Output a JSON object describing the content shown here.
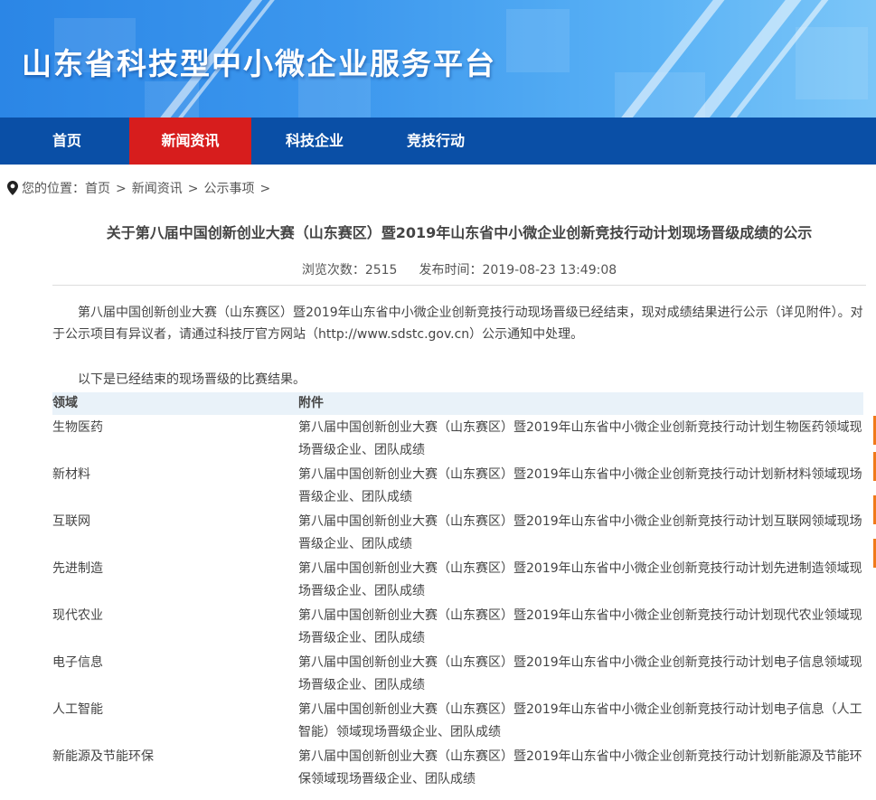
{
  "site": {
    "title": "山东省科技型中小微企业服务平台"
  },
  "nav": {
    "items": [
      {
        "label": "首页"
      },
      {
        "label": "新闻资讯"
      },
      {
        "label": "科技企业"
      },
      {
        "label": "竞技行动"
      }
    ],
    "active": "新闻资讯"
  },
  "breadcrumb": {
    "icon": "location-pin-icon",
    "prefix": "您的位置：",
    "items": [
      "首页",
      "新闻资讯",
      "公示事项"
    ],
    "separator": ">"
  },
  "article": {
    "title": "关于第八届中国创新创业大赛（山东赛区）暨2019年山东省中小微企业创新竞技行动计划现场晋级成绩的公示",
    "views_label": "浏览次数：",
    "views": "2515",
    "date_label": "发布时间：",
    "date": "2019-08-23 13:49:08",
    "paragraph1": "第八届中国创新创业大赛（山东赛区）暨2019年山东省中小微企业创新竞技行动现场晋级已经结束，现对成绩结果进行公示（详见附件）。对于公示项目有异议者，请通过科技厅官方网站（http://www.sdstc.gov.cn）公示通知中处理。",
    "paragraph2": "以下是已经结束的现场晋级的比赛结果。"
  },
  "table": {
    "headers": [
      "领域",
      "附件"
    ],
    "rows": [
      {
        "field": "生物医药",
        "attachment": "第八届中国创新创业大赛（山东赛区）暨2019年山东省中小微企业创新竞技行动计划生物医药领域现场晋级企业、团队成绩"
      },
      {
        "field": "新材料",
        "attachment": "第八届中国创新创业大赛（山东赛区）暨2019年山东省中小微企业创新竞技行动计划新材料领域现场晋级企业、团队成绩"
      },
      {
        "field": "互联网",
        "attachment": "第八届中国创新创业大赛（山东赛区）暨2019年山东省中小微企业创新竞技行动计划互联网领域现场晋级企业、团队成绩"
      },
      {
        "field": "先进制造",
        "attachment": "第八届中国创新创业大赛（山东赛区）暨2019年山东省中小微企业创新竞技行动计划先进制造领域现场晋级企业、团队成绩"
      },
      {
        "field": "现代农业",
        "attachment": "第八届中国创新创业大赛（山东赛区）暨2019年山东省中小微企业创新竞技行动计划现代农业领域现场晋级企业、团队成绩"
      },
      {
        "field": "电子信息",
        "attachment": "第八届中国创新创业大赛（山东赛区）暨2019年山东省中小微企业创新竞技行动计划电子信息领域现场晋级企业、团队成绩"
      },
      {
        "field": "人工智能",
        "attachment": "第八届中国创新创业大赛（山东赛区）暨2019年山东省中小微企业创新竞技行动计划电子信息（人工智能）领域现场晋级企业、团队成绩"
      },
      {
        "field": "新能源及节能环保",
        "attachment": "第八届中国创新创业大赛（山东赛区）暨2019年山东省中小微企业创新竞技行动计划新能源及节能环保领域现场晋级企业、团队成绩"
      }
    ]
  },
  "colors": {
    "nav_bg": "#0a4fa6",
    "nav_active": "#d71d1d",
    "banner": "#3d98ee",
    "table_header_bg": "#e9f2f9",
    "side_tab": "#f07a1a"
  }
}
